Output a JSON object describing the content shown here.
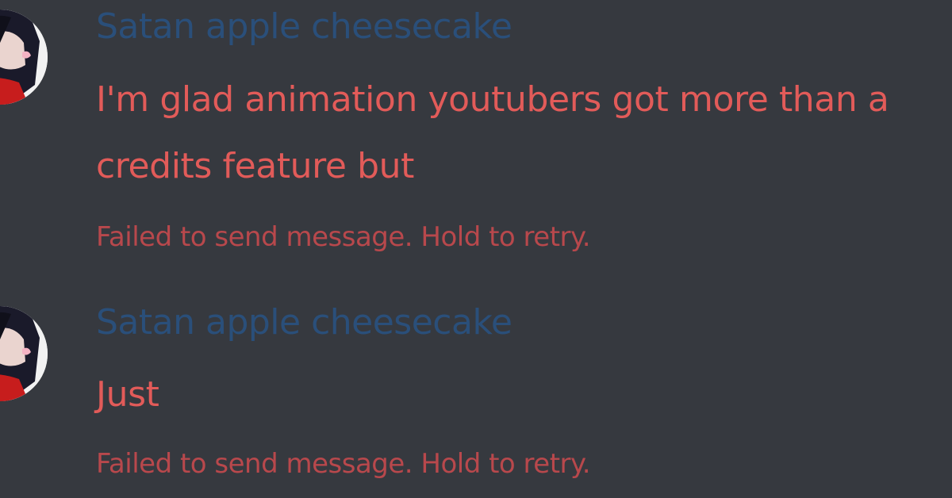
{
  "messages": [
    {
      "author": "Satan apple cheesecake",
      "content": "I'm glad animation youtubers got more than a credits feature but",
      "status": "Failed to send message. Hold to retry."
    },
    {
      "author": "Satan apple cheesecake",
      "content": "Just",
      "status": "Failed to send message. Hold to retry."
    }
  ],
  "colors": {
    "background": "#36393f",
    "author": "#2a4f7a",
    "failed_text": "#e25b59",
    "failed_status": "#b8484c"
  },
  "icons": {
    "avatar": "user-avatar-icon"
  }
}
